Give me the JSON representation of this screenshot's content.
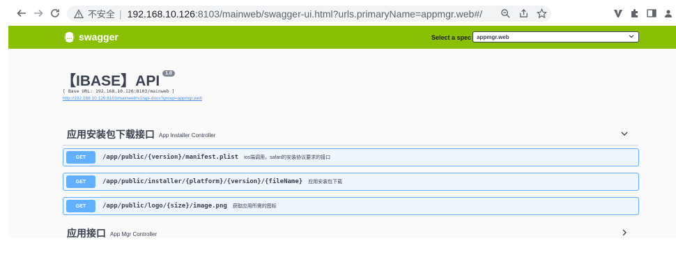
{
  "browser": {
    "insecure_label": "不安全",
    "url_host": "192.168.10.126",
    "url_rest": ":8103/mainweb/swagger-ui.html?urls.primaryName=appmgr.web#/"
  },
  "swagger": {
    "logo_text": "swagger",
    "select_spec_label": "Select a spec",
    "selected_spec": "appmgr.web"
  },
  "info": {
    "title": "【IBASE】API",
    "version": "1.0",
    "base_url": "[ Base URL: 192.168.10.126:8103/mainweb ]",
    "docs_link": "http://192.168.10.126:8103/mainweb/v2/api-docs?group=appmgr.web"
  },
  "sections": [
    {
      "name": "应用安装包下载接口",
      "description": "App Installer Controller",
      "expanded": true,
      "operations": [
        {
          "method": "GET",
          "path": "/app/public/{version}/manifest.plist",
          "summary": "ios端调用，safari的安装协议要求的接口"
        },
        {
          "method": "GET",
          "path": "/app/public/installer/{platform}/{version}/{fileName}",
          "summary": "应用安装包下载"
        },
        {
          "method": "GET",
          "path": "/app/public/logo/{size}/image.png",
          "summary": "获取应用所需的图标"
        }
      ]
    },
    {
      "name": "应用接口",
      "description": "App Mgr Controller",
      "expanded": false,
      "operations": []
    }
  ],
  "colors": {
    "topbar": "#89bf04",
    "get_method": "#61affe",
    "get_background": "#eef5fd"
  }
}
